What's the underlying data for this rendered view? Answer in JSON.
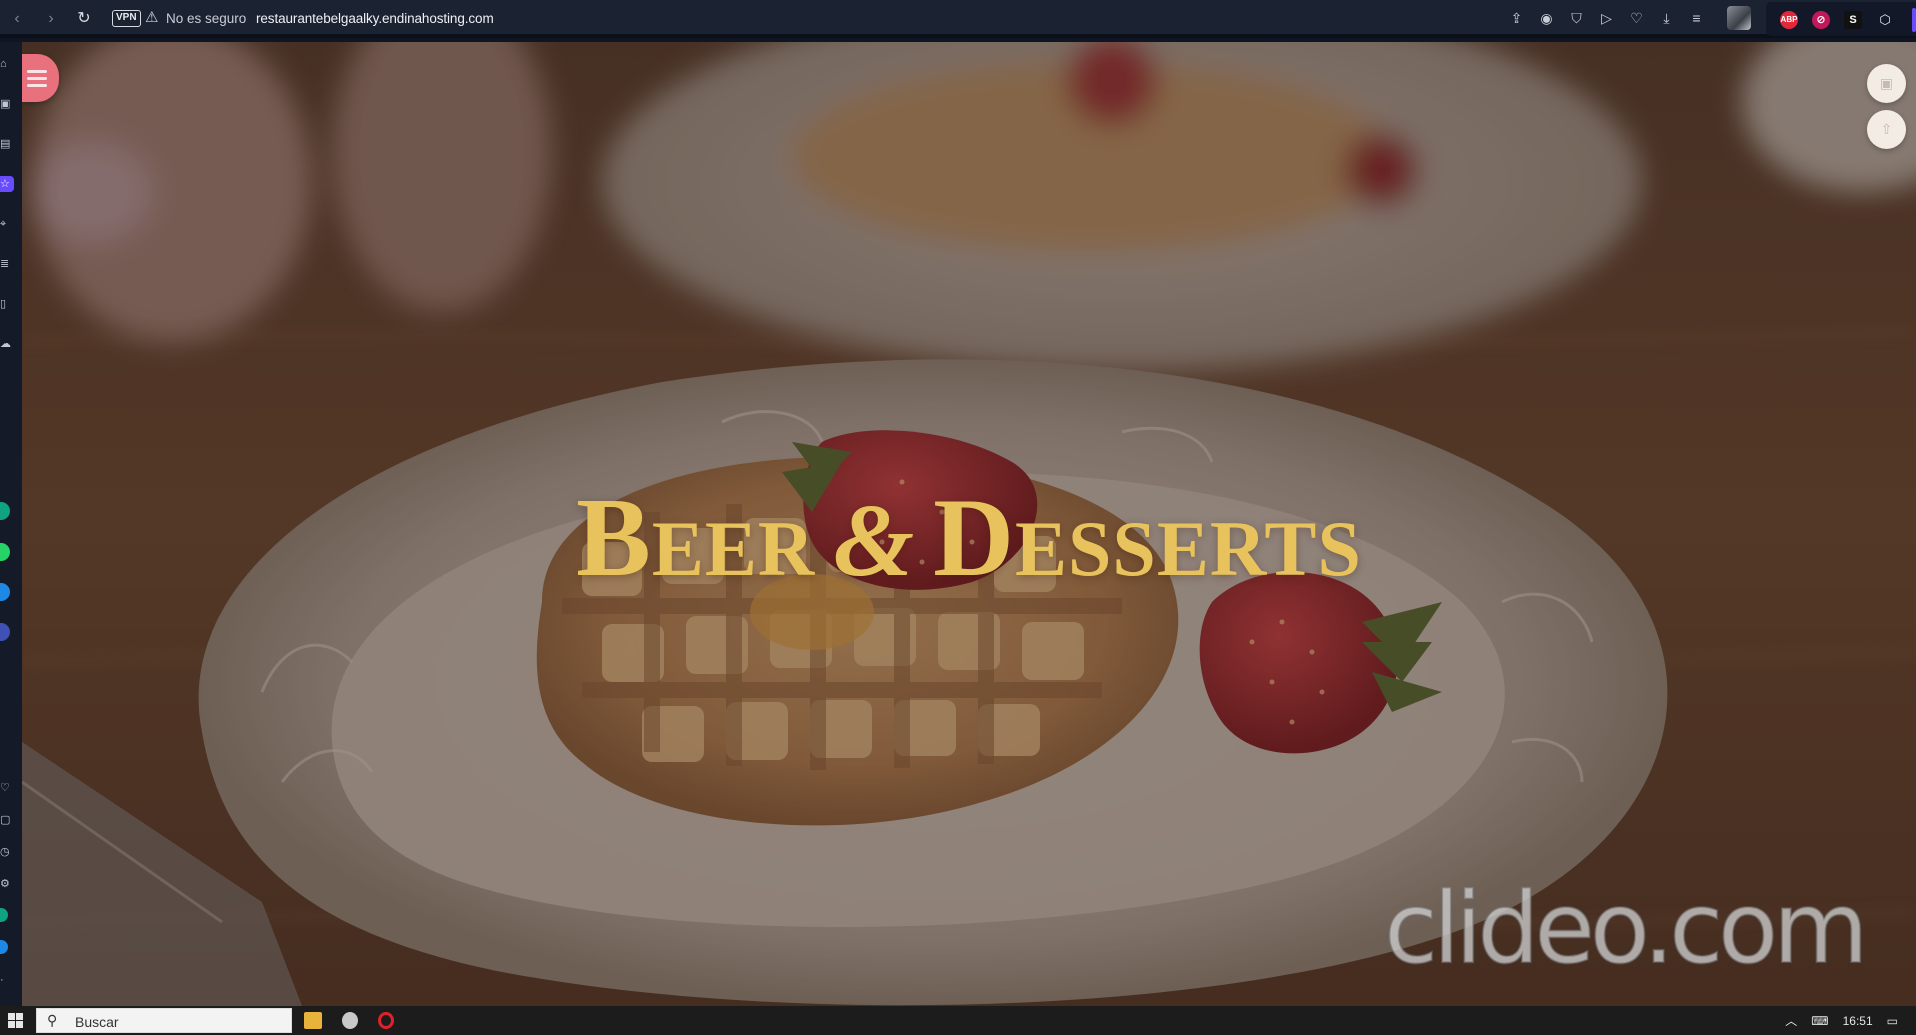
{
  "browser": {
    "vpn_label": "VPN",
    "security_text": "No es seguro",
    "url": "restaurantebelgaalky.endinahosting.com",
    "toolbar_icons": [
      "share-icon",
      "camera-icon",
      "shield-icon",
      "play-icon",
      "heart-icon",
      "download-icon",
      "menu-icon"
    ],
    "extensions": [
      {
        "name": "adblock-icon",
        "label": "ABP",
        "color": "#e2283a"
      },
      {
        "name": "no-tracking-icon",
        "label": "⊘",
        "color": "#c2185b"
      },
      {
        "name": "s-extension-icon",
        "label": "S",
        "color": "#111111"
      },
      {
        "name": "cube-extension-icon",
        "label": "⬡",
        "color": "#2b3040"
      }
    ]
  },
  "sidebar": {
    "icons": [
      "home-icon",
      "tabs-icon",
      "bookmark-icon",
      "star-icon",
      "pin-icon",
      "history-icon",
      "clipboard-icon",
      "cloud-icon",
      "chatgpt-icon",
      "whatsapp-icon",
      "messenger-icon",
      "pinterest-icon",
      "heart-icon",
      "square-icon",
      "clock-icon",
      "settings-icon",
      "app-icon",
      "translate-icon",
      "more-icon"
    ]
  },
  "hero": {
    "title_word1_initial": "B",
    "title_word1_rest": "EER",
    "title_ampersand": "&",
    "title_word2_initial": "D",
    "title_word2_rest": "ESSERTS",
    "watermark": "clideo.com"
  },
  "taskbar": {
    "search_placeholder": "Buscar",
    "time": "16:51"
  },
  "colors": {
    "title_gold": "#e8c25c",
    "menu_button": "#e8717d",
    "browser_accent": "#6a4cff"
  }
}
